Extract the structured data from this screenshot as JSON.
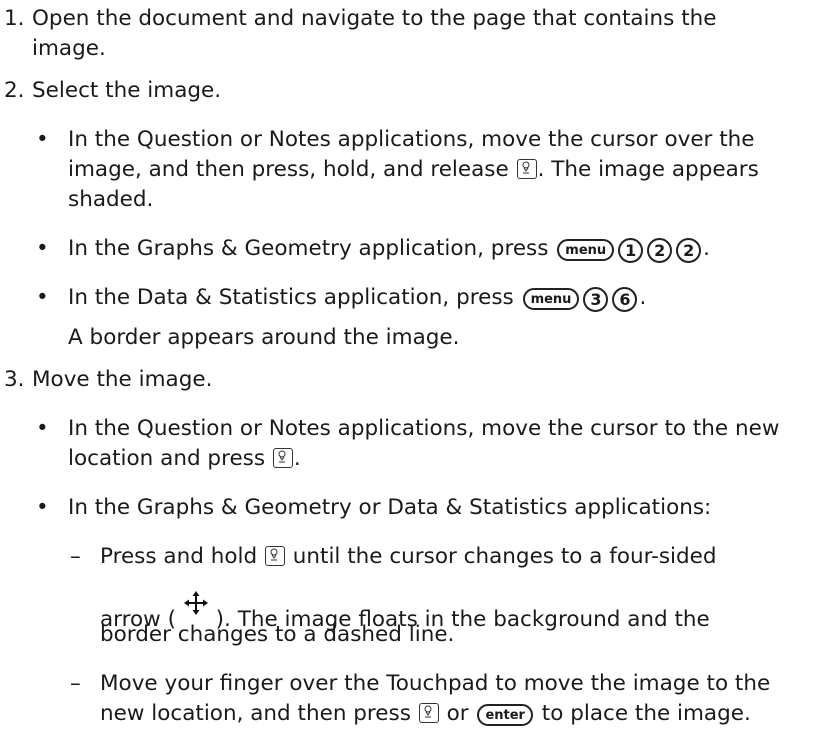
{
  "steps": {
    "s1": {
      "num": "1.",
      "l1": "Open the document and navigate to the page that contains the",
      "l2": "image."
    },
    "s2": {
      "num": "2.",
      "title": "Select the image."
    },
    "b1": {
      "l1": "In the Question or Notes applications, move the cursor over the",
      "l2a": "image, and then press, hold, and release ",
      "l2b": ". The image appears",
      "l3": "shaded."
    },
    "b2": {
      "text": "In the Graphs & Geometry application, press ",
      "key_menu": "menu",
      "k1": "1",
      "k2": "2",
      "k3": "2",
      "end": "."
    },
    "b3": {
      "text": "In the Data & Statistics application, press ",
      "key_menu": "menu",
      "k1": "3",
      "k2": "6",
      "end": "."
    },
    "border_note": "A border appears around the image.",
    "s3": {
      "num": "3.",
      "title": "Move the image."
    },
    "b4": {
      "l1": "In the Question or Notes applications, move the cursor to the new",
      "l2a": "location and press ",
      "l2b": "."
    },
    "b5": {
      "l1": "In the Graphs & Geometry or Data & Statistics applications:"
    },
    "d1": {
      "l1a": "Press and hold ",
      "l1b": " until the cursor changes to a four-sided",
      "l2a": "arrow ( ",
      "l2b": " ). The image floats in the background and the",
      "l3": "border changes to a dashed line."
    },
    "d2": {
      "l1": "Move your finger over the Touchpad to move the image to the",
      "l2a": "new location, and then press ",
      "l2b": " or ",
      "key_enter": "enter",
      "l2c": " to place the image."
    }
  },
  "icons": {
    "cursor_key": "click-key-icon",
    "four_arrow": "four-sided-arrow-icon"
  }
}
